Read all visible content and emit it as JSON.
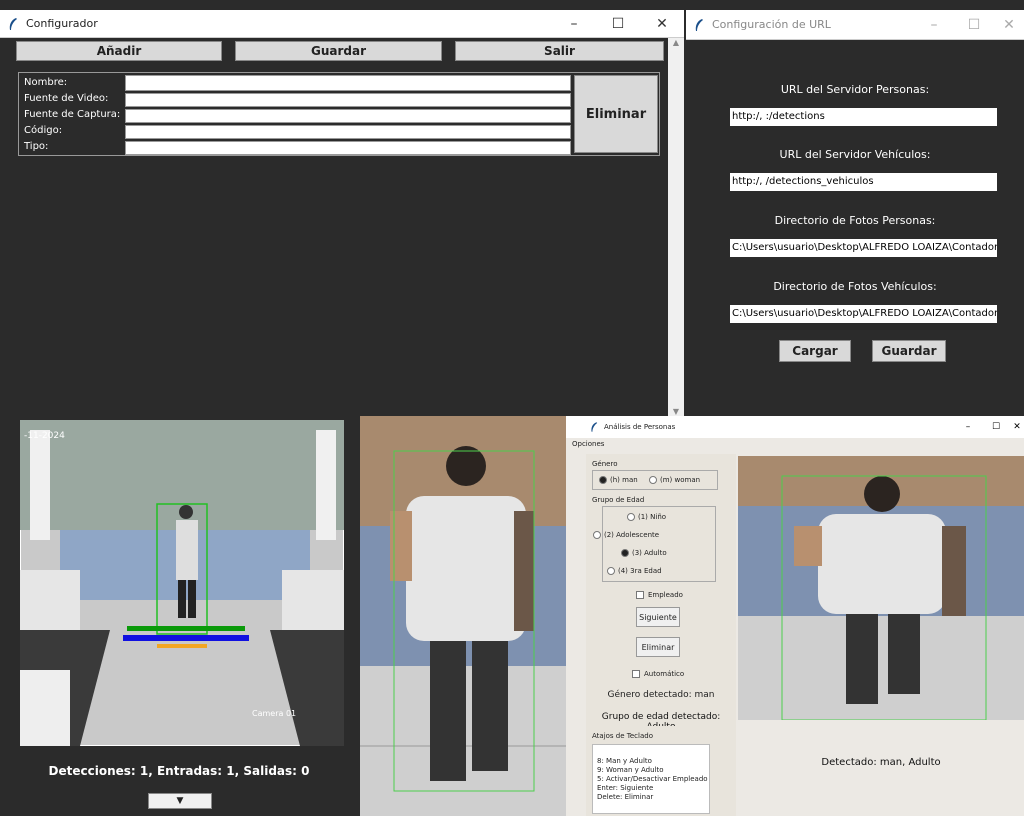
{
  "configurador": {
    "title": "Configurador",
    "buttons": {
      "add": "Añadir",
      "save": "Guardar",
      "exit": "Salir",
      "delete": "Eliminar"
    },
    "fields": [
      {
        "label": "Nombre:",
        "value": ""
      },
      {
        "label": "Fuente de Video:",
        "value": ""
      },
      {
        "label": "Fuente de Captura:",
        "value": ""
      },
      {
        "label": "Código:",
        "value": ""
      },
      {
        "label": "Tipo:",
        "value": ""
      }
    ]
  },
  "url_config": {
    "title": "Configuración de URL",
    "labels": {
      "persons_url": "URL del Servidor Personas:",
      "vehicles_url": "URL del Servidor Vehículos:",
      "persons_photos": "Directorio de Fotos Personas:",
      "vehicles_photos": "Directorio de Fotos Vehículos:"
    },
    "values": {
      "persons_url": "http:/,                        :/detections",
      "vehicles_url": "http:/,                        /detections_vehiculos",
      "persons_photos": "C:\\Users\\usuario\\Desktop\\ALFREDO LOAIZA\\Contador\\f",
      "vehicles_photos": "C:\\Users\\usuario\\Desktop\\ALFREDO LOAIZA\\Contador\\f"
    },
    "buttons": {
      "load": "Cargar",
      "save": "Guardar"
    }
  },
  "camera": {
    "timestamp": "-11-2024",
    "camera_label": "Camera 01",
    "status": "Detecciones: 1, Entradas: 1, Salidas: 0",
    "dropdown_symbol": "▼"
  },
  "analysis": {
    "title": "Análisis de Personas",
    "menu": "Opciones",
    "gender_group": "Género",
    "gender_options": [
      "(h) man",
      "(m) woman"
    ],
    "age_group": "Grupo de Edad",
    "age_options": [
      "(1) Niño",
      "(2) Adolescente",
      "(3) Adulto",
      "(4) 3ra Edad"
    ],
    "employee_label": "Empleado",
    "next_button": "Siguiente",
    "delete_button": "Eliminar",
    "automatic_label": "Automático",
    "gender_detected": "Género detectado: man",
    "age_detected": "Grupo de edad detectado: Adulto",
    "shortcuts_title": "Atajos de Teclado",
    "shortcuts": [
      "8: Man y Adulto",
      "9: Woman y Adulto",
      "5: Activar/Desactivar Empleado",
      "Enter: Siguiente",
      "Delete: Eliminar"
    ],
    "detected": "Detectado: man, Adulto"
  }
}
